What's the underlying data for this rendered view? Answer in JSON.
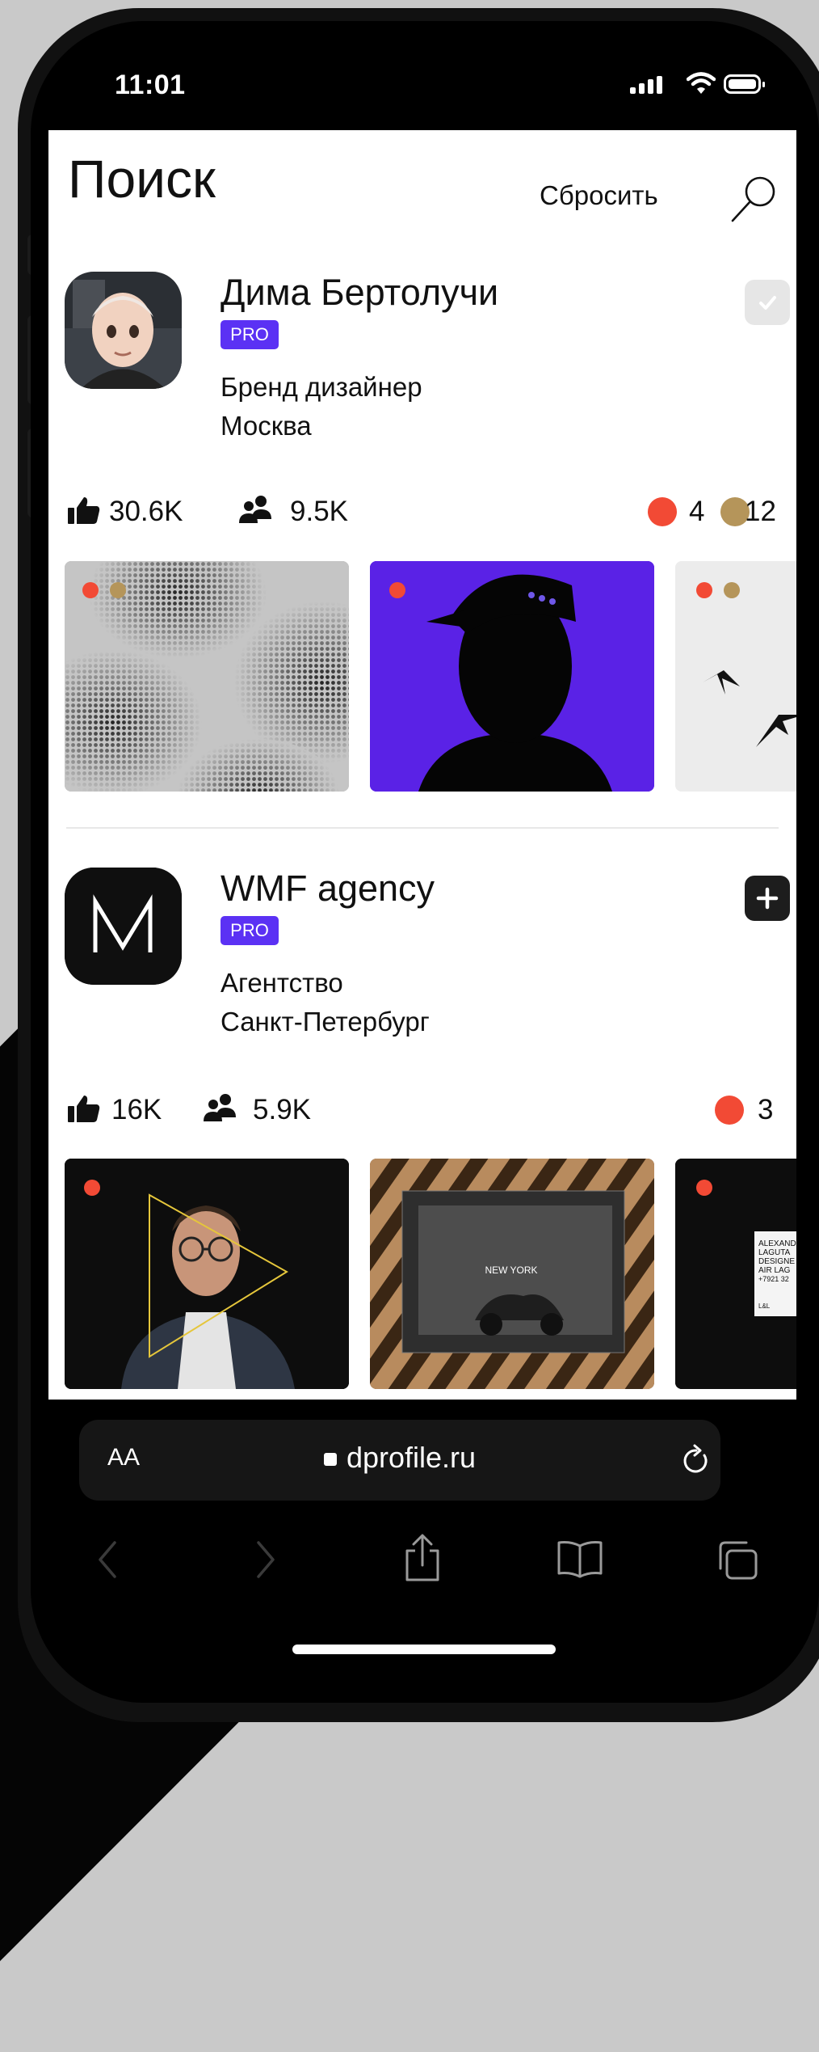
{
  "status": {
    "time": "11:01"
  },
  "page": {
    "title": "Поиск",
    "reset_label": "Сбросить"
  },
  "results": [
    {
      "name": "Дима Бертолучи",
      "badge": "PRO",
      "role": "Бренд дизайнер",
      "city": "Москва",
      "likes": "30.6K",
      "followers": "9.5K",
      "awards": [
        {
          "color": "#f24a35",
          "count": "4"
        },
        {
          "color": "#b5955a",
          "count": "12"
        }
      ],
      "action": "followed"
    },
    {
      "name": "WMF agency",
      "badge": "PRO",
      "role": "Агентство",
      "city": "Санкт-Петербург",
      "likes": "16K",
      "followers": "5.9K",
      "awards": [
        {
          "color": "#f24a35",
          "count": "3"
        }
      ],
      "action": "add"
    }
  ],
  "thumbnails": {
    "row2_second_caption": "NEW YORK",
    "row2_third_lines": [
      "ALEXAND",
      "LAGUTA",
      "DESIGNE",
      "AIR LAG",
      "+7921 32",
      "L&L"
    ]
  },
  "browser": {
    "text_size_label": "AA",
    "url": "dprofile.ru"
  },
  "icons": {
    "search": "search-icon",
    "like": "thumbs-up-icon",
    "followers": "people-icon",
    "reload": "reload-icon",
    "back": "chevron-left-icon",
    "forward": "chevron-right-icon",
    "share": "share-icon",
    "bookmarks": "book-icon",
    "tabs": "tabs-icon"
  },
  "colors": {
    "pro": "#5b31f4",
    "award_red": "#f24a35",
    "award_gold": "#b5955a"
  }
}
